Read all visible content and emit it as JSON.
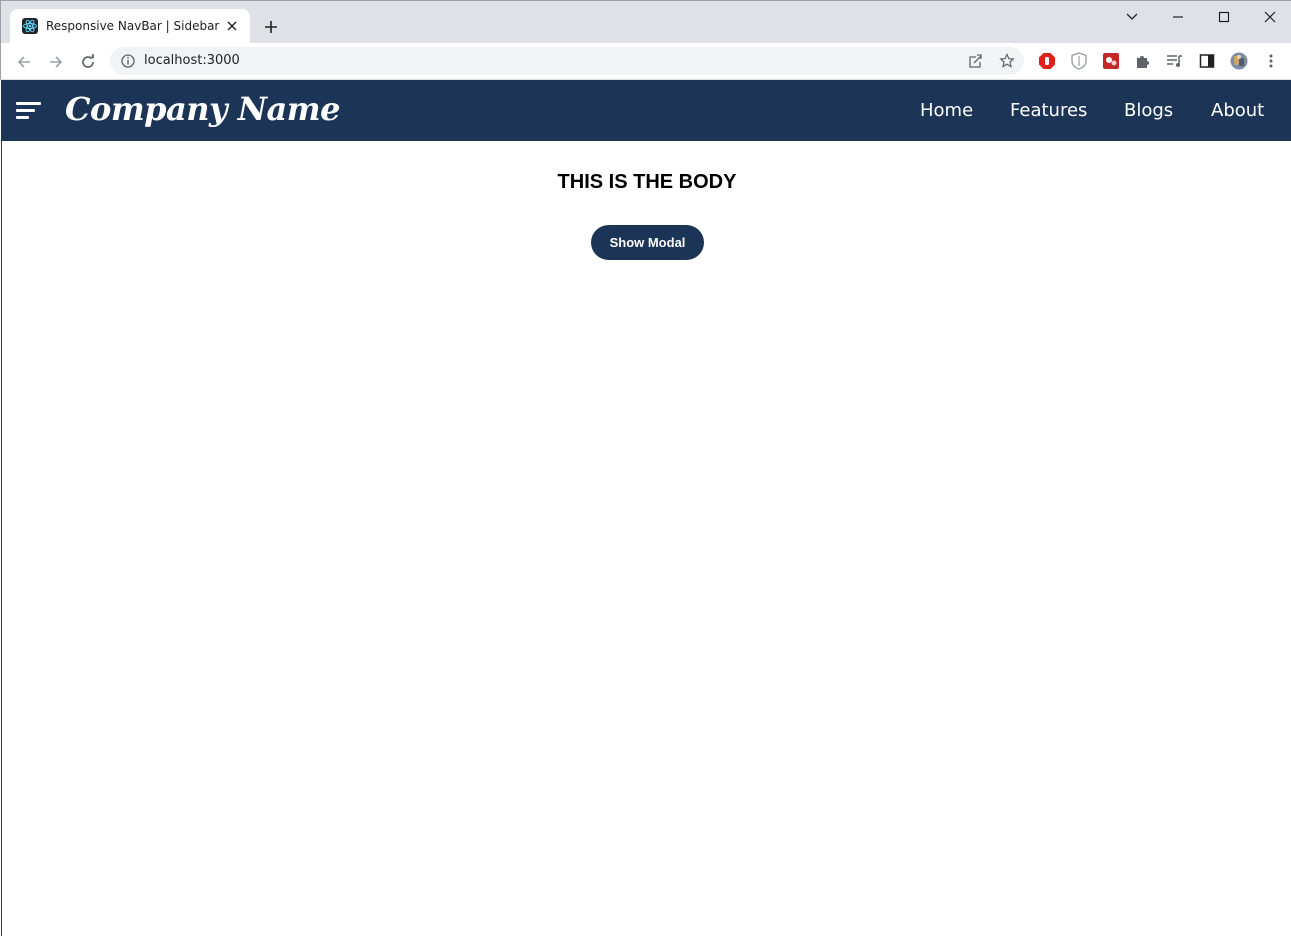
{
  "browser": {
    "tab_title": "Responsive NavBar | Sidebar",
    "url": "localhost:3000",
    "icons": {
      "favicon": "react-icon",
      "tab_close": "close-icon",
      "new_tab": "plus-icon",
      "tab_search": "chevron-down-icon",
      "minimize": "minimize-icon",
      "maximize": "maximize-icon",
      "close_window": "close-icon",
      "back": "arrow-left-icon",
      "forward": "arrow-right-icon",
      "reload": "reload-icon",
      "site_info": "info-icon",
      "share": "share-icon",
      "bookmark": "star-icon",
      "extensions": [
        "adblock-icon",
        "shield-icon",
        "extension-red-icon",
        "puzzle-icon",
        "media-queue-icon",
        "side-panel-icon",
        "profile-avatar-icon",
        "more-vert-icon"
      ]
    }
  },
  "navbar": {
    "brand": "Company Name",
    "menu_icon": "hamburger-menu-icon",
    "links": [
      "Home",
      "Features",
      "Blogs",
      "About"
    ]
  },
  "main": {
    "heading": "THIS IS THE BODY",
    "button_label": "Show Modal"
  },
  "colors": {
    "navbar_bg": "#1c3557",
    "button_bg": "#1c3557",
    "chrome_bg": "#dee1e6"
  }
}
